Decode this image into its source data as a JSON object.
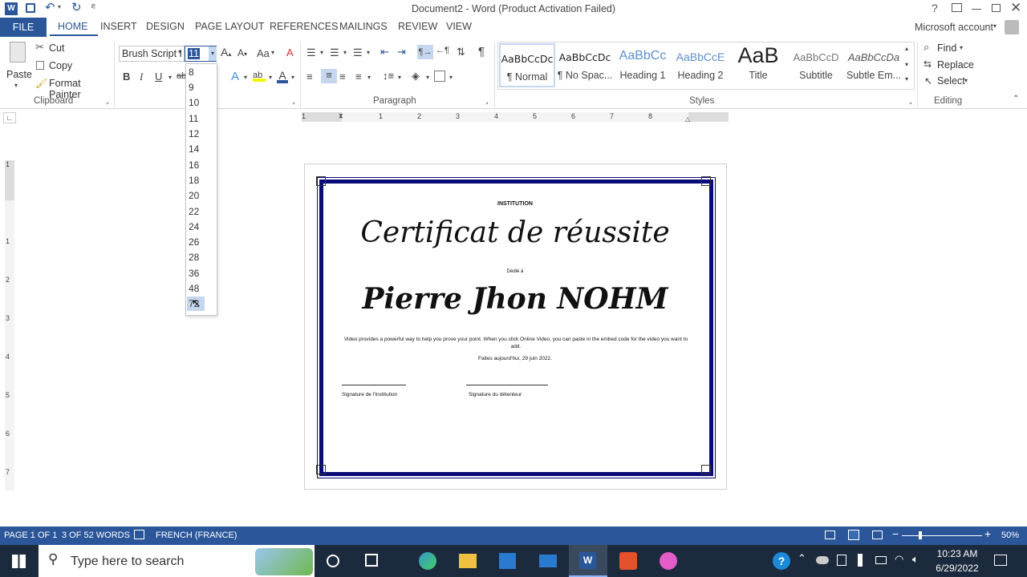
{
  "window": {
    "title": "Document2 - Word (Product Activation Failed)",
    "account": "Microsoft account"
  },
  "tabs": [
    "FILE",
    "HOME",
    "INSERT",
    "DESIGN",
    "PAGE LAYOUT",
    "REFERENCES",
    "MAILINGS",
    "REVIEW",
    "VIEW"
  ],
  "clipboard": {
    "paste": "Paste",
    "cut": "Cut",
    "copy": "Copy",
    "format_painter": "Format Painter",
    "label": "Clipboard"
  },
  "font": {
    "name": "Brush Script I",
    "size": "11",
    "bold": "B",
    "italic": "I",
    "underline": "U",
    "grow": "A",
    "case": "Aa"
  },
  "font_sizes": [
    "8",
    "9",
    "10",
    "11",
    "12",
    "14",
    "16",
    "18",
    "20",
    "22",
    "24",
    "26",
    "28",
    "36",
    "48",
    "72"
  ],
  "paragraph": {
    "label": "Paragraph"
  },
  "styles": {
    "label": "Styles",
    "items": [
      {
        "preview": "AaBbCcDc",
        "name": "¶ Normal"
      },
      {
        "preview": "AaBbCcDc",
        "name": "¶ No Spac..."
      },
      {
        "preview": "AaBbCc",
        "name": "Heading 1"
      },
      {
        "preview": "AaBbCcE",
        "name": "Heading 2"
      },
      {
        "preview": "AaB",
        "name": "Title"
      },
      {
        "preview": "AaBbCcD",
        "name": "Subtitle"
      },
      {
        "preview": "AaBbCcDa",
        "name": "Subtle Em..."
      }
    ]
  },
  "editing": {
    "find": "Find",
    "replace": "Replace",
    "select": "Select",
    "label": "Editing"
  },
  "ruler": {
    "h_ticks": [
      "1",
      "1",
      "2",
      "3",
      "4",
      "5",
      "6",
      "7",
      "8"
    ],
    "v_ticks": [
      "1",
      "1",
      "2",
      "3",
      "4",
      "5",
      "6",
      "7"
    ]
  },
  "document": {
    "institution": "INSTITUTION",
    "title": "Certificat de réussite",
    "dedicated": "Dédié à",
    "name": "Pierre Jhon NOHM",
    "body": "Video provides a powerful way to help you prove your point. When you click Online Video, you can paste in the embed code for the video you want to add.",
    "date": "Faites aujourd'hui, 29 juin 2022.",
    "sig_institution": "Signature de l'Institution",
    "sig_holder": "Signature du détenteur"
  },
  "status": {
    "page": "PAGE 1 OF 1",
    "words": "3 OF 52 WORDS",
    "language": "FRENCH (FRANCE)",
    "zoom": "50%"
  },
  "taskbar": {
    "search_placeholder": "Type here to search",
    "time": "10:23 AM",
    "date": "6/29/2022"
  },
  "colors": {
    "accent": "#2b579a",
    "frame": "#0a0a78",
    "taskbar": "#1c2a3e"
  }
}
